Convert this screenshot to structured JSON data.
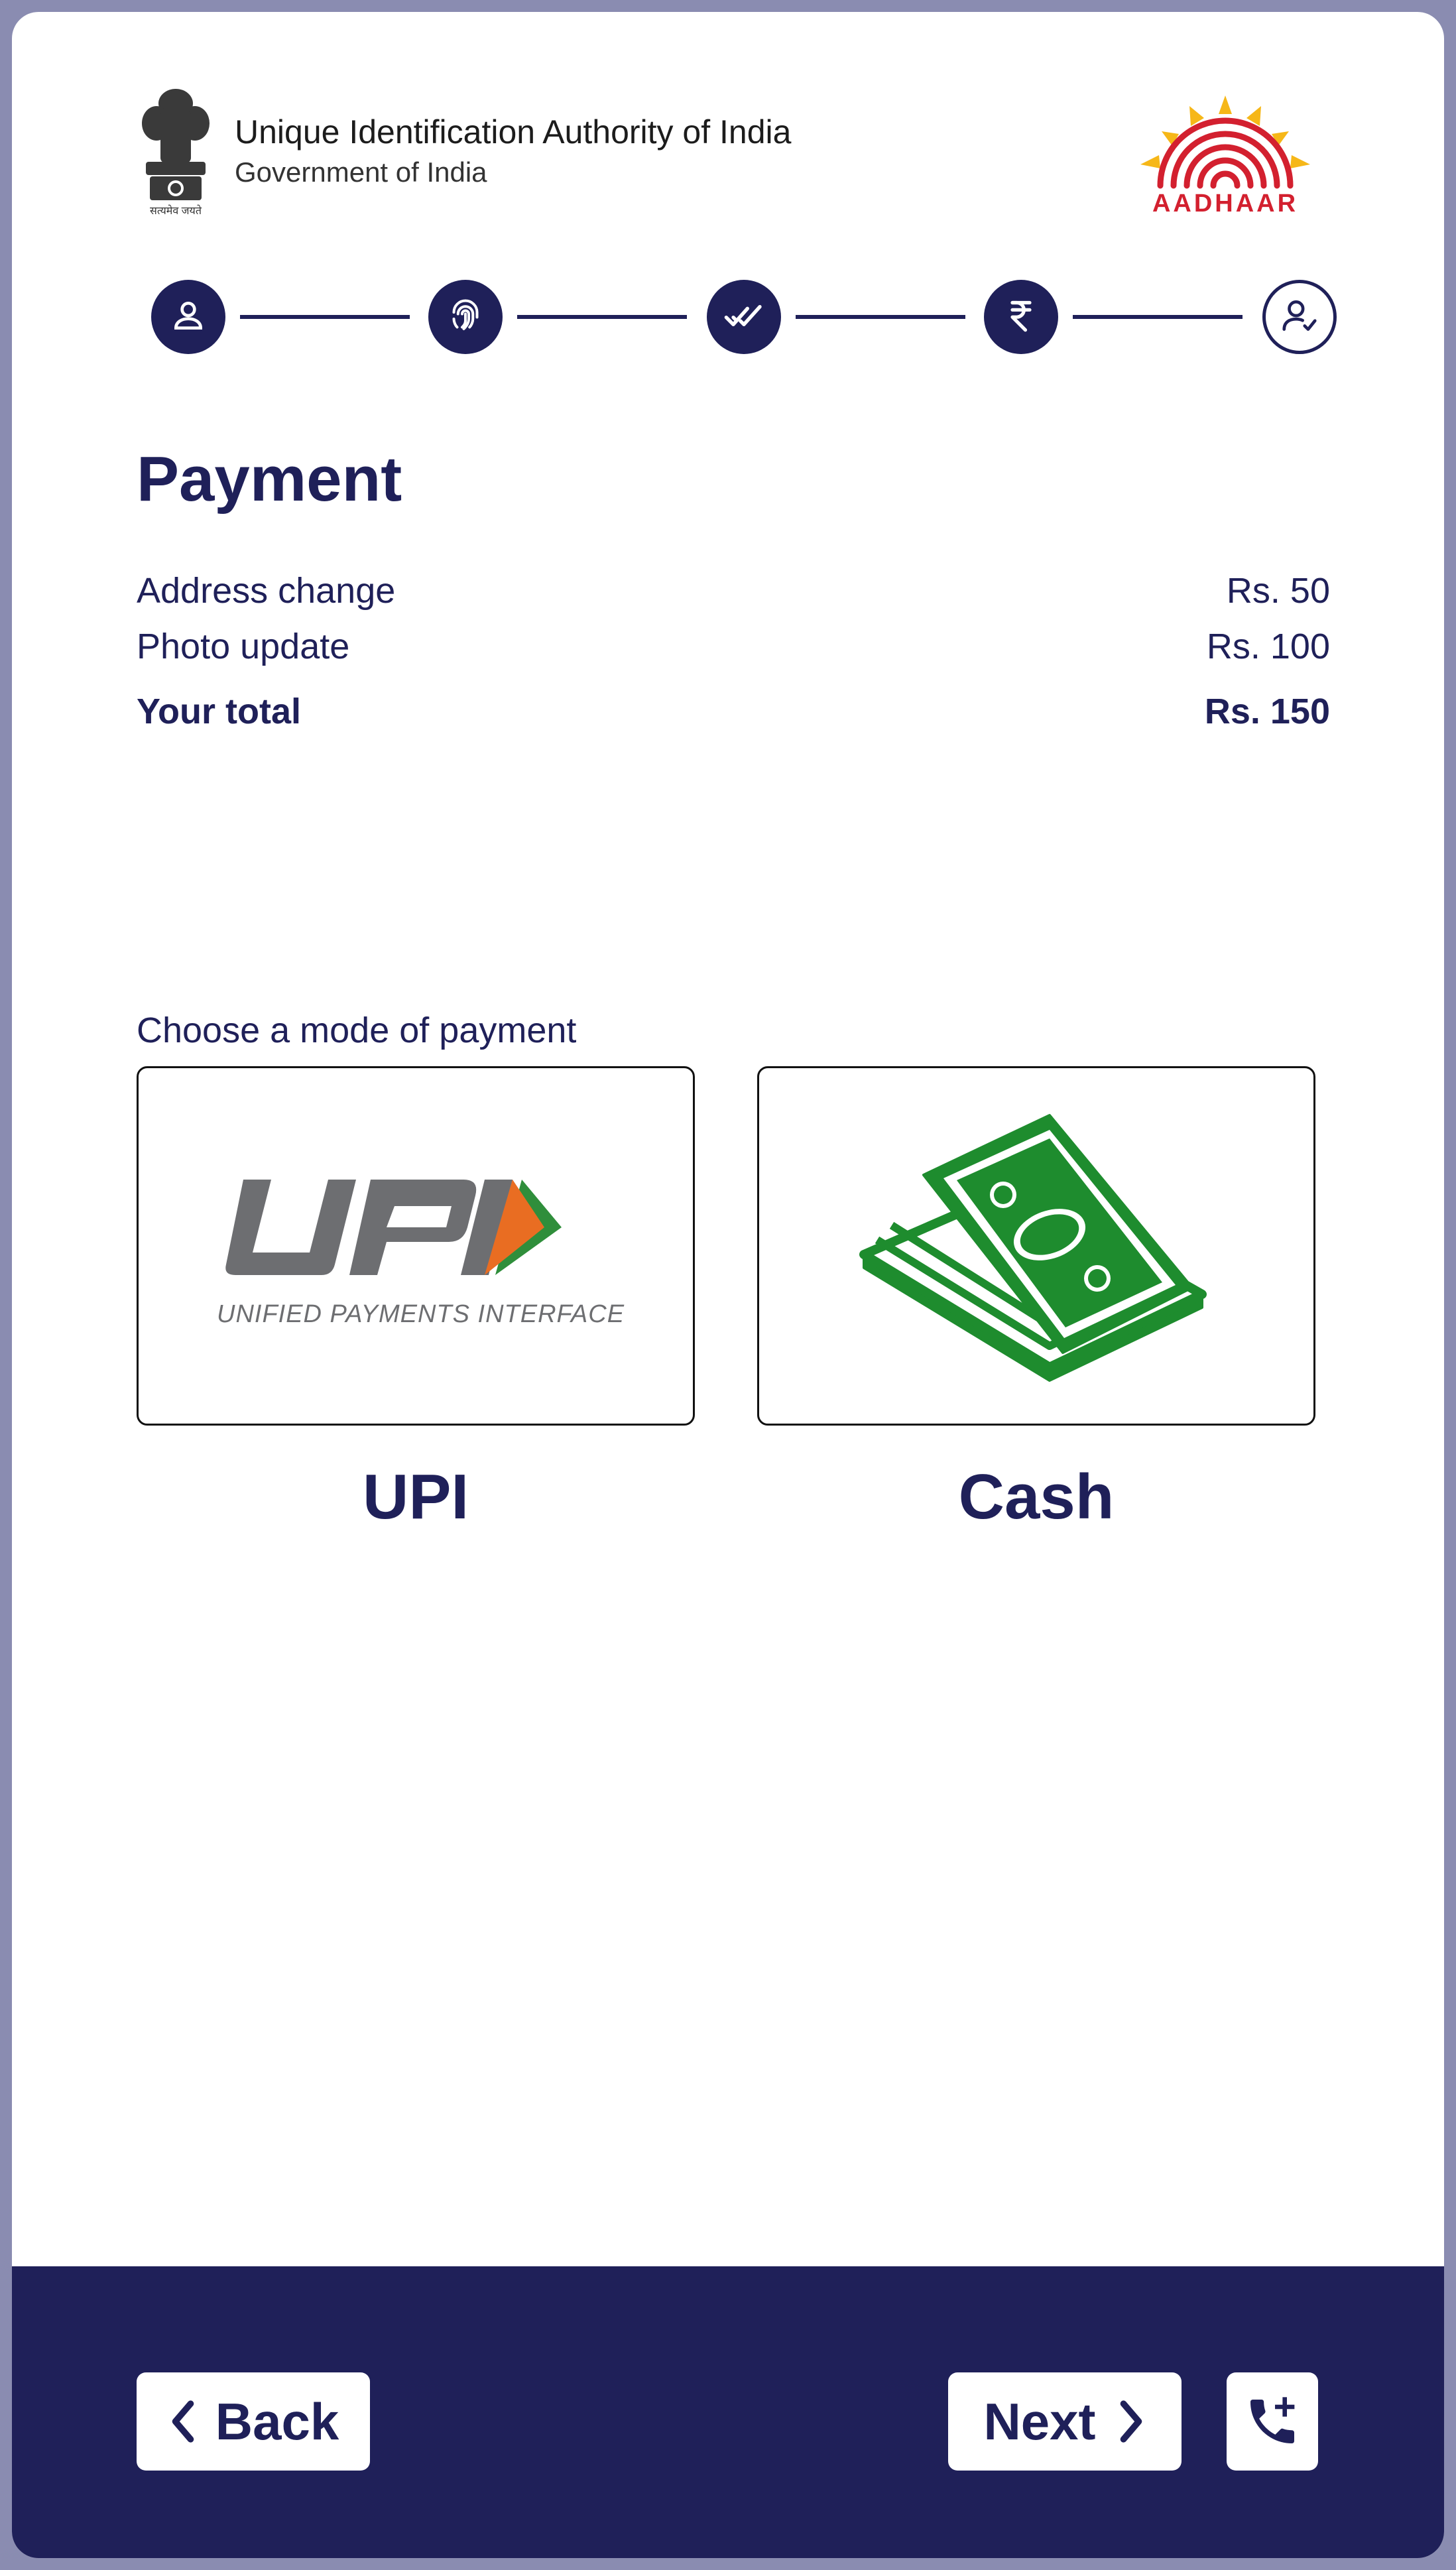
{
  "header": {
    "org_title": "Unique Identification Authority of India",
    "org_subtitle": "Government of India",
    "emblem_icon": "ashoka-emblem-icon",
    "emblem_motto": "सत्यमेव जयते",
    "aadhaar_logo_text": "AADHAAR"
  },
  "stepper": {
    "steps": [
      {
        "icon": "user-icon",
        "state": "completed"
      },
      {
        "icon": "fingerprint-icon",
        "state": "completed"
      },
      {
        "icon": "double-check-icon",
        "state": "completed"
      },
      {
        "icon": "rupee-icon",
        "state": "completed"
      },
      {
        "icon": "user-check-icon",
        "state": "pending"
      }
    ]
  },
  "payment": {
    "title": "Payment",
    "items": [
      {
        "label": "Address change",
        "amount": "Rs. 50"
      },
      {
        "label": "Photo update",
        "amount": "Rs. 100"
      }
    ],
    "total": {
      "label": "Your total",
      "amount": "Rs. 150"
    },
    "choose_label": "Choose a mode of payment",
    "modes": [
      {
        "label": "UPI",
        "logo_text": "UNIFIED PAYMENTS INTERFACE",
        "icon": "upi-logo-icon"
      },
      {
        "label": "Cash",
        "icon": "cash-bills-icon"
      }
    ]
  },
  "footer": {
    "back_label": "Back",
    "next_label": "Next",
    "help_icon": "phone-call-add-icon"
  },
  "colors": {
    "primary": "#1F2059",
    "frame": "#8A8CB1",
    "cash_green": "#1E8C2E",
    "upi_gray": "#6D6E71",
    "upi_orange": "#E96D22",
    "upi_green": "#2F8E3B",
    "aadhaar_red": "#D3202F",
    "aadhaar_yellow": "#F6B718"
  }
}
